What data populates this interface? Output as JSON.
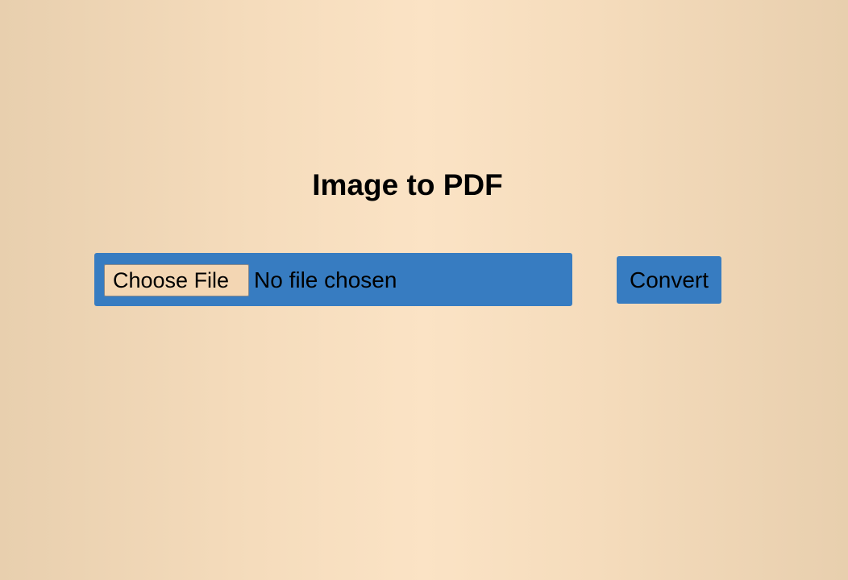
{
  "page": {
    "title": "Image to PDF"
  },
  "file_input": {
    "button_label": "Choose File",
    "status_text": "No file chosen"
  },
  "actions": {
    "convert_label": "Convert"
  },
  "colors": {
    "accent": "#377cc1",
    "background_center": "#fbe3c5",
    "background_edge": "#e8cfae"
  }
}
